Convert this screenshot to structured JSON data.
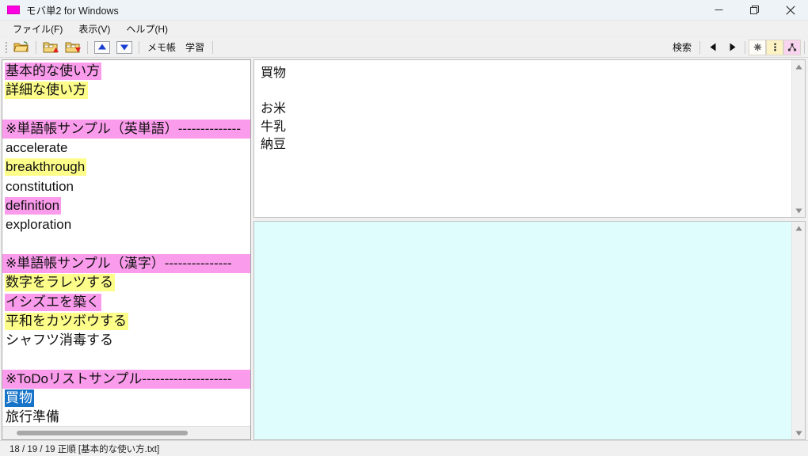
{
  "window": {
    "title": "モバ単2 for Windows",
    "app_icon": "app-icon",
    "icon_color": "#ff00e0",
    "minimize_label": "—",
    "restore_label": "❐",
    "close_label": "✕"
  },
  "menu": {
    "items": [
      {
        "label": "ファイル(F)",
        "name": "menu-file"
      },
      {
        "label": "表示(V)",
        "name": "menu-view"
      },
      {
        "label": "ヘルプ(H)",
        "name": "menu-help"
      }
    ]
  },
  "toolbar": {
    "buttons": [
      {
        "name": "open-folder-button",
        "icon": "folder-open-icon"
      },
      {
        "name": "import-button",
        "icon": "folder-import-icon"
      },
      {
        "name": "export-button",
        "icon": "folder-export-icon"
      },
      {
        "name": "move-up-button",
        "icon": "arrow-up-icon"
      },
      {
        "name": "move-down-button",
        "icon": "arrow-down-icon"
      }
    ],
    "notepad_label": "メモ帳",
    "study_label": "学習",
    "search_label": "検索",
    "prev_label": "◀",
    "next_label": "▶",
    "mark_none_label": "✳",
    "mark_yellow_label": "⠇",
    "mark_pink_label": "⚘",
    "colors": {
      "none_bg": "#fffdf7",
      "yellow_bg": "#fdf2c4",
      "pink_bg": "#f8d4ee"
    }
  },
  "left_panel": {
    "name": "word-list-panel",
    "rows": [
      {
        "text": "基本的な使い方",
        "highlight": "pink"
      },
      {
        "text": "詳細な使い方",
        "highlight": "yellow"
      },
      {
        "text": "",
        "highlight": "none"
      },
      {
        "text": "※単語帳サンプル（英単語）--------------",
        "highlight": "pink-full"
      },
      {
        "text": "accelerate",
        "highlight": "none"
      },
      {
        "text": "breakthrough",
        "highlight": "yellow"
      },
      {
        "text": "constitution",
        "highlight": "none"
      },
      {
        "text": "definition",
        "highlight": "pink"
      },
      {
        "text": "exploration",
        "highlight": "none"
      },
      {
        "text": "",
        "highlight": "none"
      },
      {
        "text": "※単語帳サンプル（漢字）---------------",
        "highlight": "pink-full"
      },
      {
        "text": "数字をラレツする",
        "highlight": "yellow"
      },
      {
        "text": "イシズエを築く",
        "highlight": "pink"
      },
      {
        "text": "平和をカツボウする",
        "highlight": "yellow"
      },
      {
        "text": "シャフツ消毒する",
        "highlight": "none"
      },
      {
        "text": "",
        "highlight": "none"
      },
      {
        "text": "※ToDoリストサンプル--------------------",
        "highlight": "pink-full"
      },
      {
        "text": "買物",
        "highlight": "selected"
      },
      {
        "text": "旅行準備",
        "highlight": "none"
      }
    ],
    "hscroll_name": "horizontal-scrollbar"
  },
  "top_right_panel": {
    "name": "detail-pane",
    "lines": [
      "買物",
      "",
      "お米",
      "牛乳",
      "納豆"
    ],
    "bg": "#ffffff"
  },
  "bottom_right_panel": {
    "name": "memo-pane",
    "lines": [],
    "bg": "#e0fdfd"
  },
  "statusbar": {
    "text": "18 / 19 / 19 正順 [基本的な使い方.txt]"
  }
}
